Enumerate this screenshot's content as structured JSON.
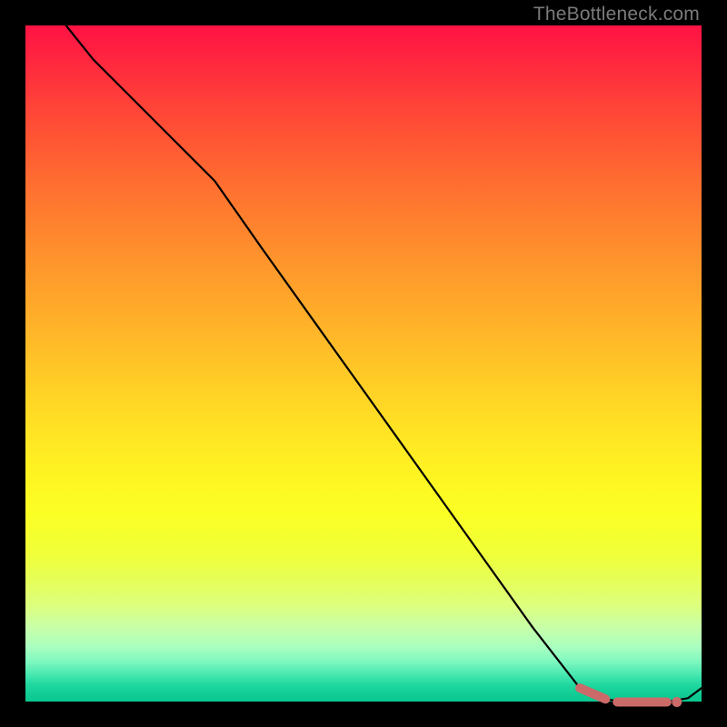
{
  "watermark": "TheBottleneck.com",
  "chart_data": {
    "type": "line",
    "title": "",
    "xlabel": "",
    "ylabel": "",
    "xlim": [
      0,
      100
    ],
    "ylim": [
      0,
      100
    ],
    "series": [
      {
        "name": "bottleneck-curve",
        "style": "solid-black",
        "x": [
          6,
          10,
          15,
          20,
          25,
          28,
          35,
          45,
          55,
          65,
          75,
          82,
          85,
          88,
          92,
          95,
          98,
          100
        ],
        "y": [
          100,
          95,
          90,
          85,
          80,
          77,
          67,
          53,
          39,
          25,
          11,
          2,
          0.5,
          0,
          0,
          0,
          0.5,
          2
        ]
      },
      {
        "name": "highlight-region",
        "style": "dashed-pink",
        "x": [
          82,
          85,
          87,
          89,
          91,
          93,
          95
        ],
        "y": [
          2,
          0.5,
          0,
          0,
          0,
          0,
          0
        ]
      }
    ],
    "annotations": []
  },
  "colors": {
    "background": "#000000",
    "line": "#000000",
    "highlight": "#cc6a6a"
  }
}
